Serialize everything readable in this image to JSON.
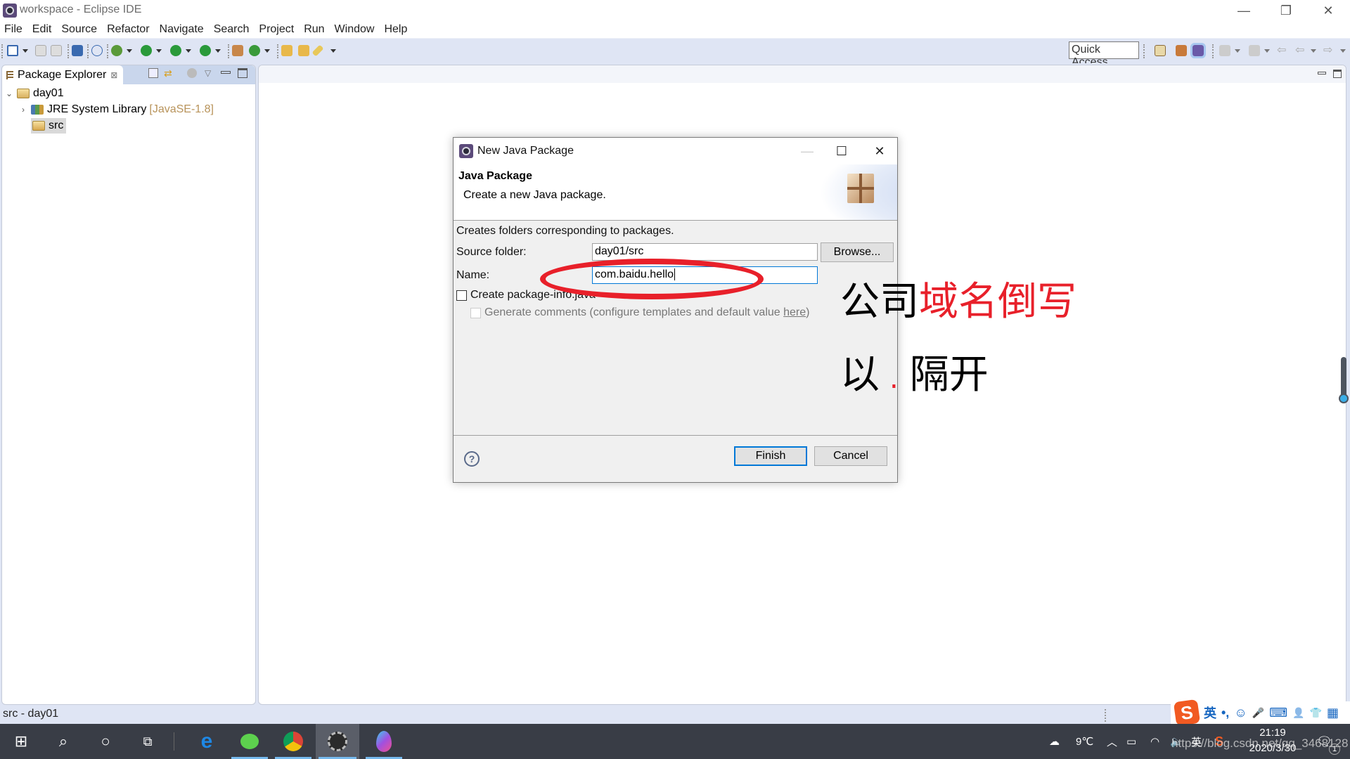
{
  "window": {
    "title": "workspace - Eclipse IDE",
    "controls": {
      "minimize": "—",
      "restore": "❐",
      "close": "✕"
    }
  },
  "menubar": {
    "items": [
      "File",
      "Edit",
      "Source",
      "Refactor",
      "Navigate",
      "Search",
      "Project",
      "Run",
      "Window",
      "Help"
    ]
  },
  "toolbar": {
    "icons": [
      "new-wizard-icon",
      "save-icon",
      "save-all-icon",
      "terminal-icon",
      "skip-breakpoints-icon",
      "debug-icon",
      "run-icon",
      "coverage-icon",
      "run-external-tool-icon",
      "new-java-package-icon",
      "new-class-icon",
      "open-type-icon",
      "open-task-icon",
      "search-icon"
    ],
    "quick_access_label": "Quick Access",
    "right_icons": [
      "open-perspective-icon",
      "java-ee-perspective-icon",
      "java-perspective-icon",
      "next-annotation-icon",
      "prev-annotation-icon",
      "last-edit-icon",
      "back-icon",
      "forward-icon"
    ]
  },
  "package_explorer": {
    "tab_label": "Package Explorer",
    "tree": [
      {
        "label": "day01",
        "expanded": true,
        "level": 0,
        "icon": "java-project-icon"
      },
      {
        "label": "JRE System Library",
        "decoration": "[JavaSE-1.8]",
        "expanded": false,
        "level": 1,
        "icon": "library-icon"
      },
      {
        "label": "src",
        "level": 1,
        "icon": "source-folder-icon",
        "selected": true
      }
    ]
  },
  "statusbar": {
    "text": "src - day01"
  },
  "dialog": {
    "title": "New Java Package",
    "banner_title": "Java Package",
    "banner_description": "Create a new Java package.",
    "info": "Creates folders corresponding to packages.",
    "source_folder_label": "Source folder:",
    "source_folder_value": "day01/src",
    "browse_label": "Browse...",
    "name_label": "Name:",
    "name_value": "com.baidu.hello",
    "create_package_info_label": "Create package-info.java",
    "create_package_info_checked": false,
    "generate_comments_prefix": "Generate comments (configure templates and default value ",
    "generate_comments_link": "here",
    "generate_comments_suffix": ")",
    "generate_comments_checked": false,
    "finish_label": "Finish",
    "cancel_label": "Cancel",
    "help_symbol": "?"
  },
  "annotation": {
    "line1_black": "公司",
    "line1_red": "域名倒写",
    "line2_prefix": "以",
    "line2_dot": ".",
    "line2_suffix": "隔开",
    "highlight_color": "#e8202a"
  },
  "ime_bar": {
    "logo": "S",
    "items": [
      "英",
      "•,",
      "☺",
      "🎤",
      "⌨",
      "👤",
      "👕",
      "▦"
    ]
  },
  "taskbar": {
    "apps": [
      "windows-start",
      "search",
      "cortana",
      "task-view",
      "edge",
      "wechat",
      "chrome",
      "eclipse-java-ee",
      "paint-3d"
    ],
    "tray": {
      "weather_temp": "9℃",
      "ime_label": "英",
      "time": "21:19",
      "date": "2020/3/30",
      "notification_count": "1"
    }
  },
  "watermark": "https://blog.csdn.net/qq_3468128"
}
